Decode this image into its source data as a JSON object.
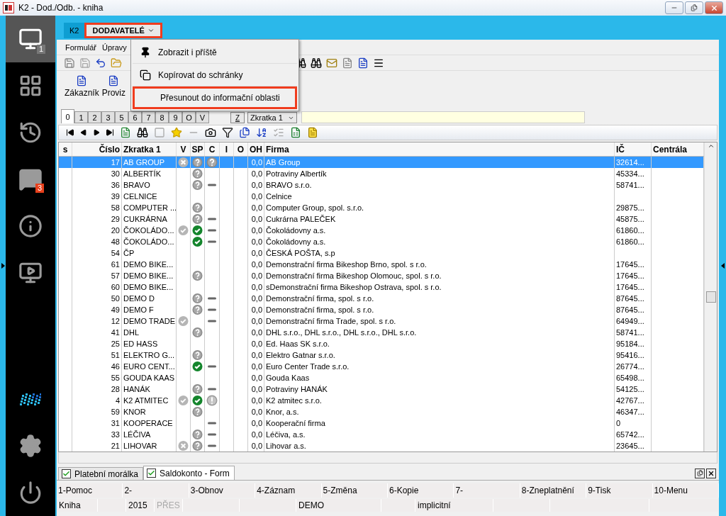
{
  "window": {
    "title": "K2 - Dod./Odb. - kniha"
  },
  "sidebar": {
    "items": [
      {
        "kind": "monitor",
        "badge": "1",
        "selected": true
      },
      {
        "kind": "apps",
        "selected": false
      },
      {
        "kind": "history",
        "selected": false
      },
      {
        "kind": "chat",
        "badge": "3",
        "selected": false
      },
      {
        "kind": "info",
        "selected": false
      },
      {
        "kind": "media",
        "selected": false
      },
      {
        "kind": "logo",
        "selected": false
      },
      {
        "kind": "settings",
        "selected": false
      },
      {
        "kind": "power",
        "selected": false
      }
    ]
  },
  "form_tabs": [
    {
      "label": "K2",
      "selected": false,
      "highlighted": false
    },
    {
      "label": "DODAVATELÉ",
      "selected": true,
      "highlighted": true
    }
  ],
  "context_menu": [
    {
      "label": "Zobrazit i příště",
      "kind": "pin",
      "highlighted": false
    },
    {
      "label": "Kopírovat do schránky",
      "kind": "copy",
      "highlighted": false
    },
    {
      "label": "Přesunout do informační oblasti",
      "kind": "plain",
      "highlighted": true
    }
  ],
  "menu_bar": [
    "Formulář",
    "Úpravy"
  ],
  "quick_buttons": [
    "Zákazník",
    "Proviz"
  ],
  "index_tabs": [
    {
      "label": "0",
      "selected": true
    },
    {
      "label": "1",
      "selected": false
    },
    {
      "label": "2",
      "selected": false
    },
    {
      "label": "3",
      "selected": false
    },
    {
      "label": "5",
      "selected": false
    },
    {
      "label": "6",
      "selected": false
    },
    {
      "label": "7",
      "selected": false
    },
    {
      "label": "8",
      "selected": false
    },
    {
      "label": "9",
      "selected": false
    },
    {
      "label": "O",
      "selected": false
    },
    {
      "label": "V",
      "selected": false
    }
  ],
  "sort_button": "Z",
  "sort_key": "Zkratka 1",
  "table": {
    "columns": [
      "s",
      "Číslo",
      "Zkratka 1",
      "V",
      "SP",
      "C",
      "I",
      "O",
      "OH",
      "Firma",
      "IČ",
      "Centrála"
    ],
    "rows": [
      {
        "cislo": "17",
        "zkratka": "AB GROUP",
        "v": {
          "kind": "cross"
        },
        "sp": {
          "kind": "question"
        },
        "c": {
          "kind": "question"
        },
        "oh": "0,0",
        "firma": "AB Group",
        "ic": "32614...",
        "selected": true
      },
      {
        "cislo": "30",
        "zkratka": "ALBERTÍK",
        "sp": {
          "kind": "question"
        },
        "oh": "0,0",
        "firma": "Potraviny Albertík",
        "ic": "45334...",
        "selected": false
      },
      {
        "cislo": "36",
        "zkratka": "BRAVO",
        "sp": {
          "kind": "question"
        },
        "c": {
          "kind": "dash"
        },
        "oh": "0,0",
        "firma": "BRAVO s.r.o.",
        "ic": "58741...",
        "selected": false
      },
      {
        "cislo": "39",
        "zkratka": "CELNICE",
        "oh": "0,0",
        "firma": "Celnice",
        "selected": false
      },
      {
        "cislo": "58",
        "zkratka": "COMPUTER ...",
        "sp": {
          "kind": "question"
        },
        "oh": "0,0",
        "firma": "Computer Group, spol. s.r.o.",
        "ic": "29875...",
        "selected": false
      },
      {
        "cislo": "29",
        "zkratka": "CUKRÁRNA",
        "sp": {
          "kind": "question"
        },
        "c": {
          "kind": "dash"
        },
        "oh": "0,0",
        "firma": "Cukrárna PALEČEK",
        "ic": "45875...",
        "selected": false
      },
      {
        "cislo": "20",
        "zkratka": "ČOKOLÁDO...",
        "v": {
          "kind": "check"
        },
        "sp": {
          "kind": "check"
        },
        "c": {
          "kind": "dash"
        },
        "oh": "0,0",
        "firma": "Čokoládovny a.s.",
        "ic": "61860...",
        "selected": false
      },
      {
        "cislo": "48",
        "zkratka": "ČOKOLÁDO...",
        "sp": {
          "kind": "check"
        },
        "c": {
          "kind": "dash"
        },
        "oh": "0,0",
        "firma": "Čokoládovny a.s.",
        "ic": "61860...",
        "selected": false
      },
      {
        "cislo": "54",
        "zkratka": "ČP",
        "oh": "0,0",
        "firma": "ČESKÁ POŠTA, s.p",
        "selected": false
      },
      {
        "cislo": "61",
        "zkratka": "DEMO BIKE...",
        "oh": "0,0",
        "firma": "Demonstrační firma Bikeshop Brno, spol. s r.o.",
        "ic": "17645...",
        "selected": false
      },
      {
        "cislo": "57",
        "zkratka": "DEMO BIKE...",
        "sp": {
          "kind": "question"
        },
        "oh": "0,0",
        "firma": "Demonstrační firma Bikeshop Olomouc, spol. s r.o.",
        "ic": "17645...",
        "selected": false
      },
      {
        "cislo": "60",
        "zkratka": "DEMO BIKE...",
        "oh": "0,0",
        "firma": "sDemonstrační firma Bikeshop Ostrava, spol. s r.o.",
        "ic": "17645...",
        "selected": false
      },
      {
        "cislo": "50",
        "zkratka": "DEMO D",
        "sp": {
          "kind": "question"
        },
        "c": {
          "kind": "dash"
        },
        "oh": "0,0",
        "firma": "Demonstrační firma, spol. s r.o.",
        "ic": "87645...",
        "selected": false
      },
      {
        "cislo": "49",
        "zkratka": "DEMO F",
        "sp": {
          "kind": "question"
        },
        "c": {
          "kind": "dash"
        },
        "oh": "0,0",
        "firma": "Demonstrační firma, spol. s r.o.",
        "ic": "87645...",
        "selected": false
      },
      {
        "cislo": "12",
        "zkratka": "DEMO TRADE",
        "v": {
          "kind": "check"
        },
        "c": {
          "kind": "dash"
        },
        "oh": "0,0",
        "firma": "Demonstrační firma Trade, spol. s r.o.",
        "ic": "64949...",
        "selected": false
      },
      {
        "cislo": "41",
        "zkratka": "DHL",
        "sp": {
          "kind": "question"
        },
        "oh": "0,0",
        "firma": "DHL s.r.o., DHL s.r.o., DHL s.r.o., DHL s.r.o.",
        "ic": "58741...",
        "selected": false
      },
      {
        "cislo": "25",
        "zkratka": "ED HASS",
        "oh": "0,0",
        "firma": "Ed. Haas SK s.r.o.",
        "ic": "95184...",
        "selected": false
      },
      {
        "cislo": "51",
        "zkratka": "ELEKTRO G...",
        "sp": {
          "kind": "question"
        },
        "oh": "0,0",
        "firma": "Elektro Gatnar s.r.o.",
        "ic": "95416...",
        "selected": false
      },
      {
        "cislo": "46",
        "zkratka": "EURO CENT...",
        "sp": {
          "kind": "check"
        },
        "c": {
          "kind": "dash"
        },
        "oh": "0,0",
        "firma": "Euro Center Trade s.r.o.",
        "ic": "26774...",
        "selected": false
      },
      {
        "cislo": "55",
        "zkratka": "GOUDA KAAS",
        "oh": "0,0",
        "firma": "Gouda Kaas",
        "ic": "65498...",
        "selected": false
      },
      {
        "cislo": "28",
        "zkratka": "HANÁK",
        "sp": {
          "kind": "question"
        },
        "c": {
          "kind": "dash"
        },
        "oh": "0,0",
        "firma": "Potraviny HANÁK",
        "ic": "54125...",
        "selected": false
      },
      {
        "cislo": "4",
        "zkratka": "K2 ATMITEC",
        "v": {
          "kind": "check"
        },
        "sp": {
          "kind": "check"
        },
        "c": {
          "kind": "exclamation"
        },
        "oh": "0,0",
        "firma": "K2 atmitec s.r.o.",
        "ic": "42767...",
        "selected": false
      },
      {
        "cislo": "59",
        "zkratka": "KNOR",
        "sp": {
          "kind": "question"
        },
        "oh": "0,0",
        "firma": "Knor, a.s.",
        "ic": "46347...",
        "selected": false
      },
      {
        "cislo": "31",
        "zkratka": "KOOPERACE",
        "c": {
          "kind": "dash"
        },
        "oh": "0,0",
        "firma": "Kooperační firma",
        "ic": "0",
        "selected": false
      },
      {
        "cislo": "33",
        "zkratka": "LÉČIVA",
        "sp": {
          "kind": "question"
        },
        "c": {
          "kind": "dash"
        },
        "oh": "0,0",
        "firma": "Léčiva, a.s.",
        "ic": "65742...",
        "selected": false
      },
      {
        "cislo": "21",
        "zkratka": "LIHOVAR",
        "v": {
          "kind": "cross"
        },
        "sp": {
          "kind": "question"
        },
        "c": {
          "kind": "dash"
        },
        "oh": "0,0",
        "firma": "Lihovar a.s.",
        "ic": "23645...",
        "selected": false
      }
    ]
  },
  "bottom_tabs": [
    {
      "label": "Platební morálka",
      "checked": true,
      "selected": false
    },
    {
      "label": "Saldokonto - Form",
      "checked": true,
      "selected": true
    }
  ],
  "function_keys": [
    "1-Pomoc",
    "2-",
    "3-Obnov",
    "4-Záznam",
    "5-Změna",
    "6-Kopie",
    "7-",
    "8-Zneplatnění",
    "9-Tisk",
    "10-Menu"
  ],
  "status_bar": [
    {
      "text": "Kniha",
      "disabled": false
    },
    {
      "text": "2015",
      "disabled": false
    },
    {
      "text": "PŘES",
      "disabled": true
    },
    {
      "text": "DEMO",
      "disabled": false
    },
    {
      "text": "implicitní",
      "disabled": false
    }
  ]
}
